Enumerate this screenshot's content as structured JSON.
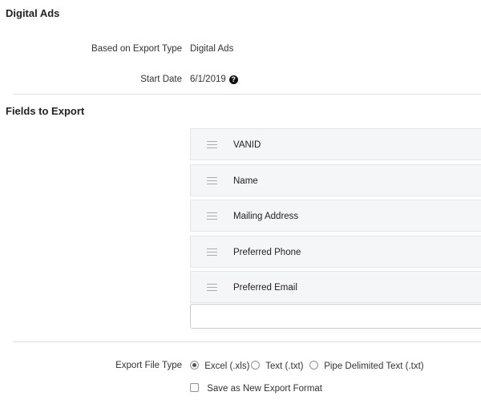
{
  "header": {
    "title": "Digital Ads"
  },
  "details": {
    "export_type_label": "Based on Export Type",
    "export_type_value": "Digital Ads",
    "start_date_label": "Start Date",
    "start_date_value": "6/1/2019",
    "help_icon": "question-circle-icon"
  },
  "fields_section": {
    "title": "Fields to Export",
    "fields": [
      {
        "label": "VANID"
      },
      {
        "label": "Name"
      },
      {
        "label": "Mailing Address"
      },
      {
        "label": "Preferred Phone"
      },
      {
        "label": "Preferred Email"
      }
    ],
    "drag_icon": "drag-handle-icon",
    "new_field_value": ""
  },
  "file_type": {
    "label": "Export File Type",
    "options": [
      {
        "label": "Excel (.xls)",
        "selected": true
      },
      {
        "label": "Text (.txt)",
        "selected": false
      },
      {
        "label": "Pipe Delimited Text (.txt)",
        "selected": false
      }
    ]
  },
  "save_as_new": {
    "label": "Save as New Export Format",
    "checked": false
  }
}
